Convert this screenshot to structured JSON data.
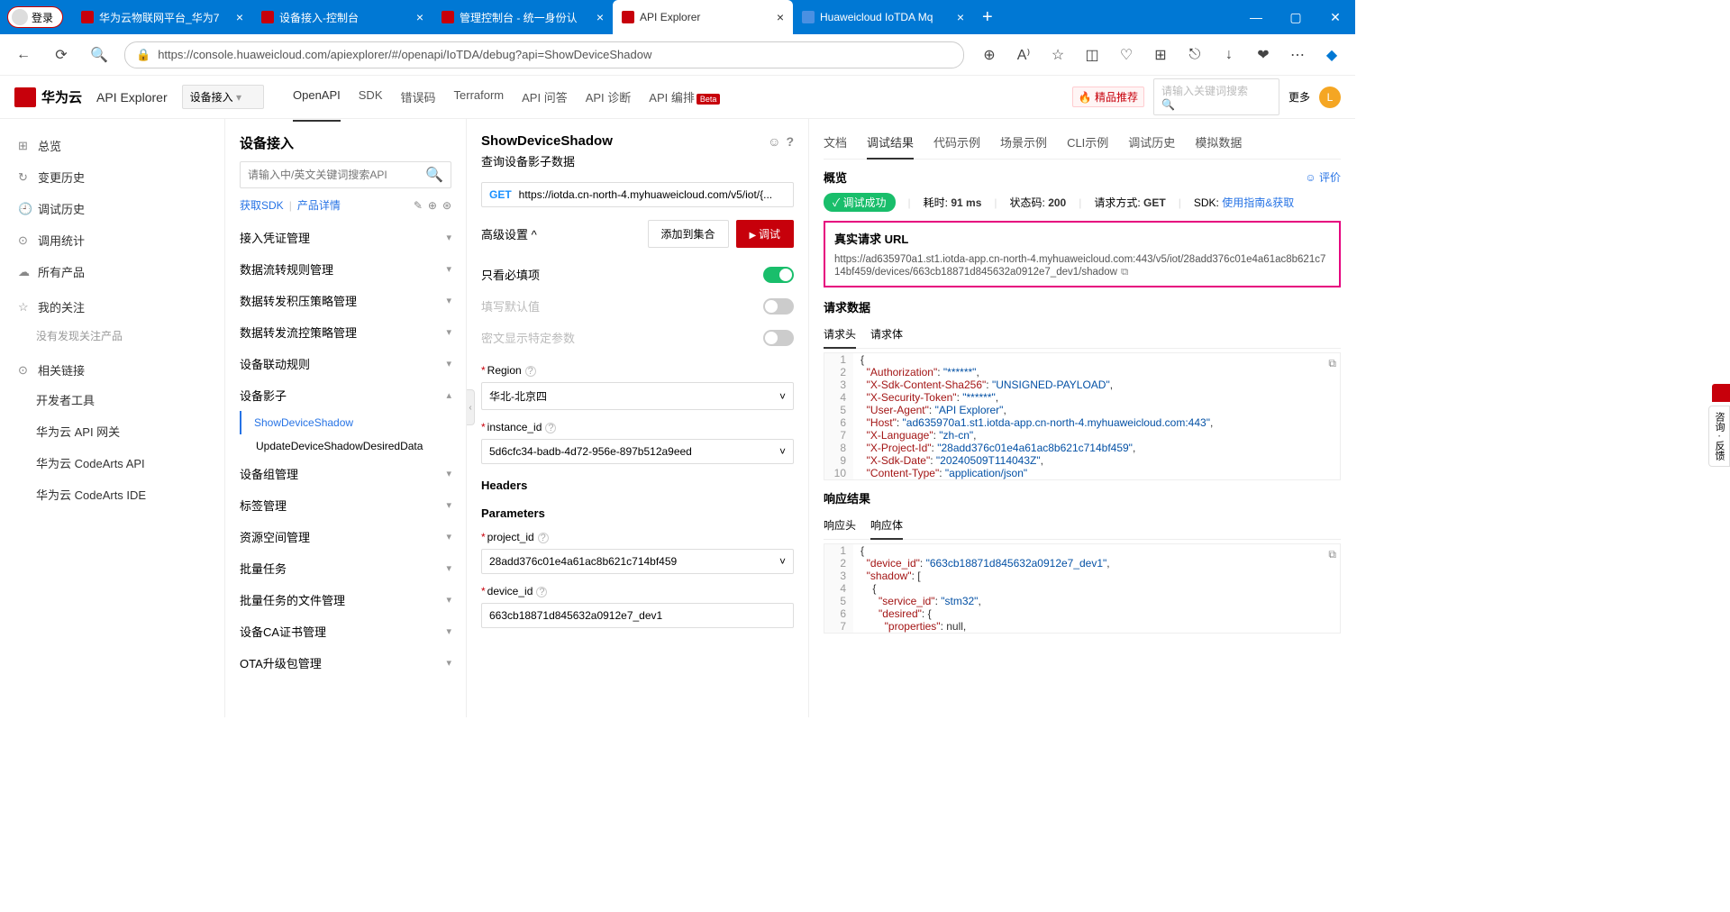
{
  "browser": {
    "login": "登录",
    "tabs": [
      {
        "label": "华为云物联网平台_华为7",
        "active": false,
        "fav": "hw"
      },
      {
        "label": "设备接入-控制台",
        "active": false,
        "fav": "hw"
      },
      {
        "label": "管理控制台 - 统一身份认",
        "active": false,
        "fav": "hw"
      },
      {
        "label": "API Explorer",
        "active": true,
        "fav": "hw"
      },
      {
        "label": "Huaweicloud IoTDA Mq",
        "active": false,
        "fav": "doc"
      }
    ],
    "url": "https://console.huaweicloud.com/apiexplorer/#/openapi/IoTDA/debug?api=ShowDeviceShadow",
    "win": {
      "min": "—",
      "max": "▢",
      "close": "✕"
    }
  },
  "topnav": {
    "brand": "华为云",
    "product": "API Explorer",
    "select": "设备接入",
    "tabs": [
      "OpenAPI",
      "SDK",
      "错误码",
      "Terraform",
      "API 问答",
      "API 诊断",
      "API 编排"
    ],
    "active_tab": "OpenAPI",
    "beta_on": "API 编排",
    "promo": "🔥 精品推荐",
    "search_ph": "请输入关键词搜索",
    "more": "更多",
    "avatar": "L"
  },
  "left": {
    "items": [
      {
        "icon": "⊞",
        "label": "总览"
      },
      {
        "icon": "↻",
        "label": "变更历史"
      },
      {
        "icon": "🕘",
        "label": "调试历史"
      },
      {
        "icon": "⊙",
        "label": "调用统计"
      },
      {
        "icon": "☁",
        "label": "所有产品"
      }
    ],
    "follow": {
      "icon": "☆",
      "label": "我的关注",
      "empty": "没有发现关注产品"
    },
    "links": {
      "icon": "⊙",
      "label": "相关链接",
      "items": [
        "开发者工具",
        "华为云 API 网关",
        "华为云 CodeArts API",
        "华为云 CodeArts IDE"
      ]
    }
  },
  "tree": {
    "title": "设备接入",
    "search_ph": "请输入中/英文关键词搜索API",
    "sdk": "获取SDK",
    "detail": "产品详情",
    "groups": [
      {
        "label": "接入凭证管理",
        "open": false
      },
      {
        "label": "数据流转规则管理",
        "open": false
      },
      {
        "label": "数据转发积压策略管理",
        "open": false
      },
      {
        "label": "数据转发流控策略管理",
        "open": false
      },
      {
        "label": "设备联动规则",
        "open": false
      },
      {
        "label": "设备影子",
        "open": true,
        "children": [
          {
            "label": "ShowDeviceShadow",
            "active": true
          },
          {
            "label": "UpdateDeviceShadowDesiredData",
            "active": false
          }
        ]
      },
      {
        "label": "设备组管理",
        "open": false
      },
      {
        "label": "标签管理",
        "open": false
      },
      {
        "label": "资源空间管理",
        "open": false
      },
      {
        "label": "批量任务",
        "open": false
      },
      {
        "label": "批量任务的文件管理",
        "open": false
      },
      {
        "label": "设备CA证书管理",
        "open": false
      },
      {
        "label": "OTA升级包管理",
        "open": false
      }
    ]
  },
  "api": {
    "name": "ShowDeviceShadow",
    "desc": "查询设备影子数据",
    "method": "GET",
    "url": "https://iotda.cn-north-4.myhuaweicloud.com/v5/iot/{...",
    "adv": "高级设置",
    "add_collect": "添加到集合",
    "debug": "调试",
    "opts": {
      "only_required": "只看必填项",
      "fill_default": "填写默认值",
      "show_secret": "密文显示特定参数"
    },
    "fields": {
      "region": {
        "label": "Region",
        "value": "华北-北京四",
        "req": true
      },
      "instance_id": {
        "label": "instance_id",
        "value": "5d6cfc34-badb-4d72-956e-897b512a9eed",
        "req": true
      },
      "headers": "Headers",
      "parameters": "Parameters",
      "project_id": {
        "label": "project_id",
        "value": "28add376c01e4a61ac8b621c714bf459",
        "req": true
      },
      "device_id": {
        "label": "device_id",
        "value": "663cb18871d845632a0912e7_dev1",
        "req": true
      }
    }
  },
  "result": {
    "tabs": [
      "文档",
      "调试结果",
      "代码示例",
      "场景示例",
      "CLI示例",
      "调试历史",
      "模拟数据"
    ],
    "active": "调试结果",
    "overview": "概览",
    "eval": "评价",
    "status": {
      "success": "✓ 调试成功",
      "time_l": "耗时:",
      "time_v": "91 ms",
      "code_l": "状态码:",
      "code_v": "200",
      "method_l": "请求方式:",
      "method_v": "GET",
      "sdk_l": "SDK:",
      "sdk_a": "使用指南&获取"
    },
    "real_url_l": "真实请求 URL",
    "real_url": "https://ad635970a1.st1.iotda-app.cn-north-4.myhuaweicloud.com:443/v5/iot/28add376c01e4a61ac8b621c714bf459/devices/663cb18871d845632a0912e7_dev1/shadow",
    "req_data": "请求数据",
    "req_tabs": [
      "请求头",
      "请求体"
    ],
    "req_active": "请求头",
    "req_headers": [
      {
        "n": 1,
        "raw": "{"
      },
      {
        "n": 2,
        "k": "Authorization",
        "v": "******",
        "c": ","
      },
      {
        "n": 3,
        "k": "X-Sdk-Content-Sha256",
        "v": "UNSIGNED-PAYLOAD",
        "c": ","
      },
      {
        "n": 4,
        "k": "X-Security-Token",
        "v": "******",
        "c": ","
      },
      {
        "n": 5,
        "k": "User-Agent",
        "v": "API Explorer",
        "c": ","
      },
      {
        "n": 6,
        "k": "Host",
        "v": "ad635970a1.st1.iotda-app.cn-north-4.myhuaweicloud.com:443",
        "c": ","
      },
      {
        "n": 7,
        "k": "X-Language",
        "v": "zh-cn",
        "c": ","
      },
      {
        "n": 8,
        "k": "X-Project-Id",
        "v": "28add376c01e4a61ac8b621c714bf459",
        "c": ","
      },
      {
        "n": 9,
        "k": "X-Sdk-Date",
        "v": "20240509T114043Z",
        "c": ","
      },
      {
        "n": 10,
        "k": "Content-Type",
        "v": "application/json",
        "c": ""
      }
    ],
    "resp_l": "响应结果",
    "resp_tabs": [
      "响应头",
      "响应体"
    ],
    "resp_active": "响应体",
    "resp_body": [
      {
        "n": 1,
        "raw": "{"
      },
      {
        "n": 2,
        "k": "device_id",
        "v": "663cb18871d845632a0912e7_dev1",
        "c": ","
      },
      {
        "n": 3,
        "k": "shadow",
        "raw2": ": ["
      },
      {
        "n": 4,
        "raw": "    {"
      },
      {
        "n": 5,
        "k": "service_id",
        "v": "stm32",
        "c": ",",
        "indent": "      "
      },
      {
        "n": 6,
        "k": "desired",
        "raw2": ": {",
        "indent": "      "
      },
      {
        "n": 7,
        "k": "properties",
        "raw2": ": null,",
        "indent": "        "
      }
    ]
  },
  "feedback": "咨询 · 反馈"
}
